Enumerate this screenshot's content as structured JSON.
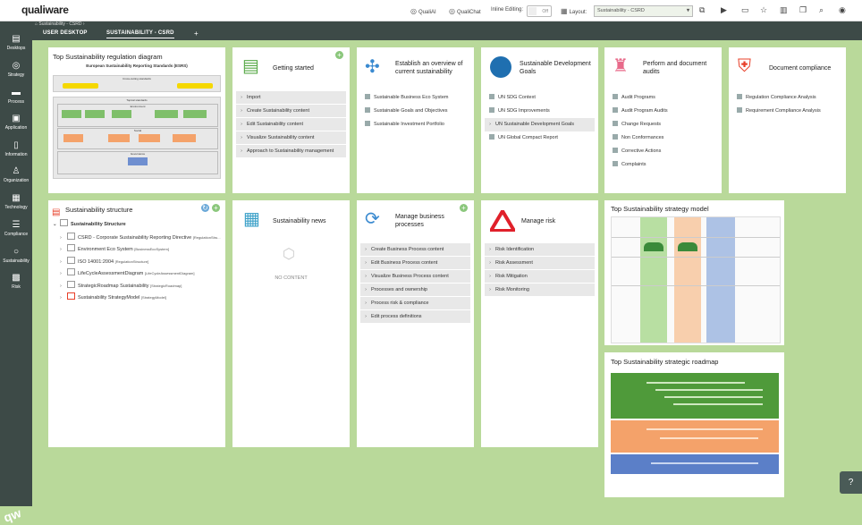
{
  "topbar": {
    "logo": "qualiware",
    "qualiai": "QualiAI",
    "qualichat": "QualiChat",
    "inline_editing": "Inline Editing:",
    "toggle": "Off",
    "layout_label": "Layout:",
    "layout_value": "Sustainability - CSRD"
  },
  "sidebar": {
    "items": [
      "Desktops",
      "Strategy",
      "Process",
      "Application",
      "Information",
      "Organization",
      "Technology",
      "Compliance",
      "Sustainability",
      "Risk"
    ],
    "brand": "qw"
  },
  "tabs": {
    "breadcrumb": "Sustainability - CSRD",
    "tab1": "USER DESKTOP",
    "tab2": "SUSTAINABILITY - CSRD",
    "add": "+"
  },
  "cards": {
    "regulation": {
      "title": "Top Sustainability regulation diagram",
      "diagram_title": "European Sustainability Reporting Standards (ESRS)",
      "band1": "Cross-cutting standards",
      "band2": "Topical standards",
      "sub1": "Environment",
      "sub2": "Social",
      "sub3": "Governance"
    },
    "getting_started": {
      "title": "Getting started",
      "items": [
        "Import",
        "Create Sustainability content",
        "Edit Sustainability content",
        "Visualize Sustainability content",
        "Approach to Sustainability management"
      ]
    },
    "overview": {
      "title": "Establish an overview of current sustainability",
      "items": [
        "Sustainable Business Eco System",
        "Sustainable Goals and Objectives",
        "Sustainable Investment Portfolio"
      ]
    },
    "sdg": {
      "title": "Sustainable Development Goals",
      "items": [
        "UN SDG Context",
        "UN SDG Improvements",
        "UN Sustainable Development Goals",
        "UN Global Compact Report"
      ]
    },
    "audits": {
      "title": "Perform and document audits",
      "items": [
        "Audit Programs",
        "Audit Program Audits",
        "Change Requests",
        "Non Conformances",
        "Corrective Actions",
        "Complaints"
      ]
    },
    "compliance": {
      "title": "Document compliance",
      "items": [
        "Regulation Compliance Analysis",
        "Requirement Compliance Analysis"
      ]
    },
    "structure": {
      "title": "Sustainability structure",
      "root": "Sustainability Structure",
      "rows": [
        {
          "name": "CSRD - Corporate Sustainability Reporting Directive",
          "type": "[RegulationStru..."
        },
        {
          "name": "Environment Eco System",
          "type": "[BusinessEcoSystem]"
        },
        {
          "name": "ISO 14001:2004",
          "type": "[RegulationStructure]"
        },
        {
          "name": "LifeCycleAssessmentDiagram",
          "type": "[LifeCycleAssessmentDiagram]"
        },
        {
          "name": "StrategicRoadmap Sustainability",
          "type": "[StrategicRoadmap]"
        },
        {
          "name": "Sustainability StrategyModel",
          "type": "[StrategyModel]"
        }
      ]
    },
    "news": {
      "title": "Sustainability news",
      "empty": "NO CONTENT"
    },
    "bpm": {
      "title": "Manage business processes",
      "items": [
        "Create Business Process content",
        "Edit Business Process content",
        "Visualize Business Process content",
        "Processes and ownership",
        "Process risk & compliance",
        "Edit process definitions"
      ]
    },
    "risk": {
      "title": "Manage risk",
      "items": [
        "Risk Identification",
        "Risk Assessment",
        "Risk Mitigation",
        "Risk Monitoring"
      ]
    },
    "strategy_model": {
      "title": "Top Sustainability strategy model"
    },
    "roadmap": {
      "title": "Top Sustainability strategic roadmap"
    }
  },
  "help": "?",
  "colors": {
    "background": "#b9d99a",
    "sidebar": "#3d4a47",
    "accent_green": "#8bc77c",
    "risk_red": "#e0202a"
  }
}
